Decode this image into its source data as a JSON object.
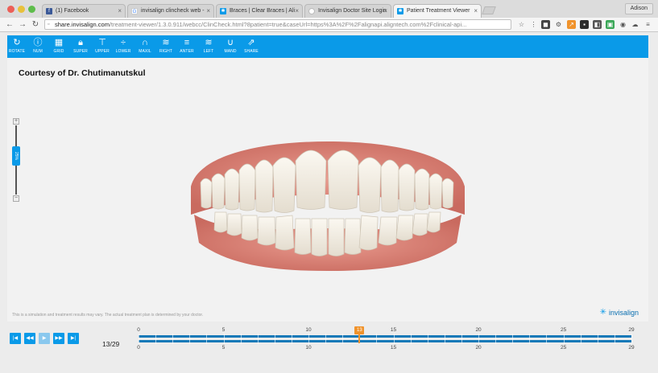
{
  "browser": {
    "tabs": [
      {
        "title": "(1) Facebook",
        "favicon": "facebook-icon",
        "color": "#3b5998",
        "active": false
      },
      {
        "title": "invisalign clincheck web -",
        "favicon": "google-icon",
        "color": "#4285f4",
        "active": false
      },
      {
        "title": "Braces | Clear Braces | Ali",
        "favicon": "invisalign-icon",
        "color": "#0a9ae8",
        "active": false
      },
      {
        "title": "Invisalign Doctor Site Login",
        "favicon": "loading-icon",
        "color": "#999999",
        "active": false
      },
      {
        "title": "Patient Treatment Viewer",
        "favicon": "invisalign-icon",
        "color": "#0a9ae8",
        "active": true
      }
    ],
    "user": "Adison",
    "url_host": "share.invisalign.com",
    "url_path": "/treatment-viewer/1.3.0.911/webcc/ClinCheck.html?8patient=true&caseUrl=https%3A%2F%2Falignapi.aligntech.com%2Fclinical-api..."
  },
  "toolbar": {
    "accent": "#0a9ae8",
    "items": [
      {
        "label": "ROTATE",
        "icon": "rotate-icon"
      },
      {
        "label": "NUM",
        "icon": "info-icon"
      },
      {
        "label": "GRID",
        "icon": "grid-icon"
      },
      {
        "label": "SUPER",
        "icon": "lock-icon"
      },
      {
        "label": "UPPER",
        "icon": "upper-icon"
      },
      {
        "label": "LOWER",
        "icon": "lower-icon"
      },
      {
        "label": "MAXIL",
        "icon": "maxil-icon"
      },
      {
        "label": "RIGHT",
        "icon": "right-icon"
      },
      {
        "label": "ANTER",
        "icon": "anterior-icon"
      },
      {
        "label": "LEFT",
        "icon": "left-icon"
      },
      {
        "label": "MAND",
        "icon": "mandible-icon"
      },
      {
        "label": "SHARE",
        "icon": "share-icon"
      }
    ]
  },
  "viewer": {
    "courtesy": "Courtesy of Dr. Chutimanutskul",
    "disclaimer": "This is a simulation and treatment results may vary. The actual treatment plan is determined by your doctor.",
    "logo_text": "invisalign",
    "zoom_label": "25%"
  },
  "playback": {
    "current_stage": 13,
    "total_stages": 29,
    "stage_text": "13/29",
    "buttons": [
      "first-stage-icon",
      "prev-stage-icon",
      "play-icon",
      "next-stage-icon",
      "last-stage-icon"
    ],
    "tick_labels": [
      "0",
      "5",
      "10",
      "15",
      "20",
      "25",
      "29"
    ],
    "marker_color": "#f0932c"
  }
}
